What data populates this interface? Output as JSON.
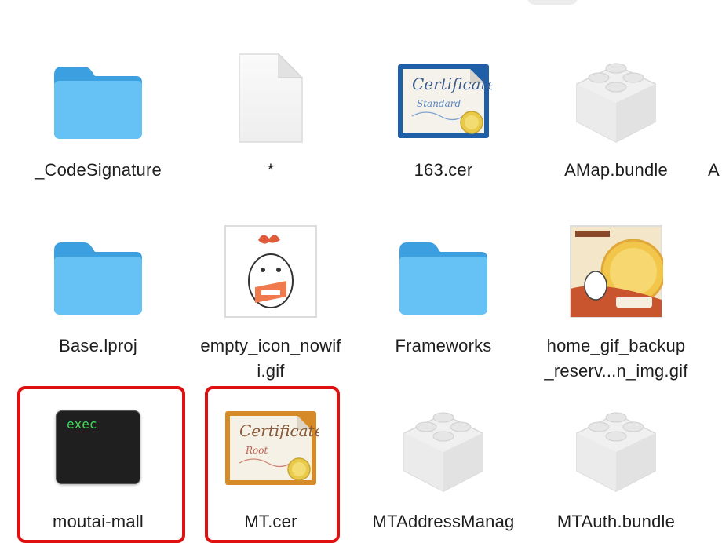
{
  "items": [
    {
      "name": "_CodeSignature",
      "icon": "folder-icon"
    },
    {
      "name": "*",
      "icon": "blank-document-icon"
    },
    {
      "name": "163.cer",
      "icon": "certificate-standard-icon",
      "cert_title": "Certificate",
      "cert_sub": "Standard"
    },
    {
      "name": "AMap.bundle",
      "icon": "bundle-icon"
    },
    {
      "name": "Base.lproj",
      "icon": "folder-icon"
    },
    {
      "name": "empty_icon_nowifi.gif",
      "name_line1": "empty_icon_nowif",
      "name_line2": "i.gif",
      "icon": "gif-thumbnail-icon"
    },
    {
      "name": "Frameworks",
      "icon": "folder-icon"
    },
    {
      "name": "home_gif_backup_reserv...n_img.gif",
      "name_line1": "home_gif_backup",
      "name_line2": "_reserv...n_img.gif",
      "icon": "gif-thumbnail-icon"
    },
    {
      "name": "moutai-mall",
      "icon": "exec-icon",
      "exec_text": "exec",
      "highlighted": true
    },
    {
      "name": "MT.cer",
      "icon": "certificate-root-icon",
      "cert_title": "Certificate",
      "cert_sub": "Root",
      "highlighted": true
    },
    {
      "name": "MTAddressManag",
      "icon": "bundle-icon"
    },
    {
      "name": "MTAuth.bundle",
      "icon": "bundle-icon"
    }
  ],
  "cut_off_label": "A",
  "colors": {
    "folder": "#5bb8f0",
    "highlight": "#e11010",
    "exec_text": "#3ddc5a"
  }
}
